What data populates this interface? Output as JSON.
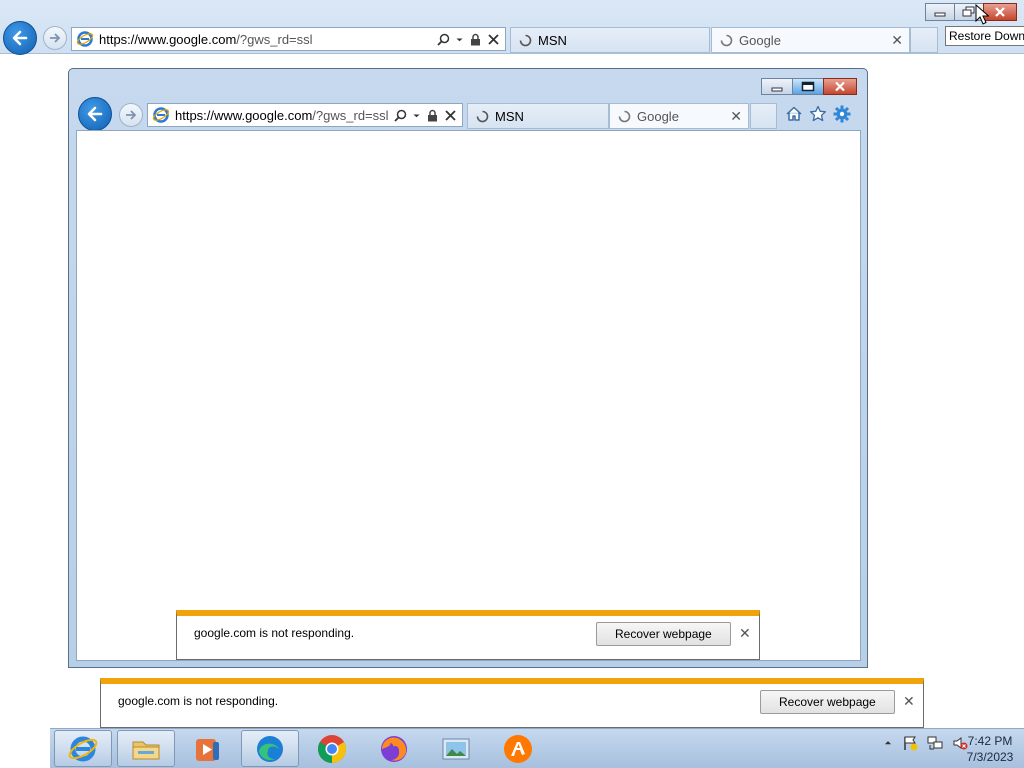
{
  "outer_browser": {
    "address": {
      "host": "https://www.google.com",
      "rest": "/?gws_rd=ssl"
    },
    "tabs": [
      {
        "label": "MSN",
        "state": "inactive"
      },
      {
        "label": "Google",
        "state": "active"
      }
    ],
    "tooltip": "Restore Down"
  },
  "inner_browser": {
    "address": {
      "host": "https://www.google.com",
      "rest": "/?gws_rd=ssl"
    },
    "tabs": [
      {
        "label": "MSN",
        "state": "inactive"
      },
      {
        "label": "Google",
        "state": "active"
      }
    ],
    "notification": {
      "message": "google.com is not responding.",
      "button": "Recover webpage"
    }
  },
  "outer_notification": {
    "message": "google.com is not responding.",
    "button": "Recover webpage"
  },
  "taskbar": {
    "pinned": [
      "Internet Explorer",
      "File Explorer",
      "Windows Media Player",
      "Microsoft Edge",
      "Google Chrome",
      "Mozilla Firefox",
      "Photo Viewer",
      "Avast"
    ],
    "clock": {
      "time": "7:42 PM",
      "date": "7/3/2023"
    },
    "tray_icons": [
      "show-hidden-icons",
      "action-center-flag",
      "network",
      "volume-muted"
    ]
  },
  "colors": {
    "accent_blue": "#125fb3",
    "notification_bar": "#f0a30a",
    "close_red": "#c5462f"
  }
}
